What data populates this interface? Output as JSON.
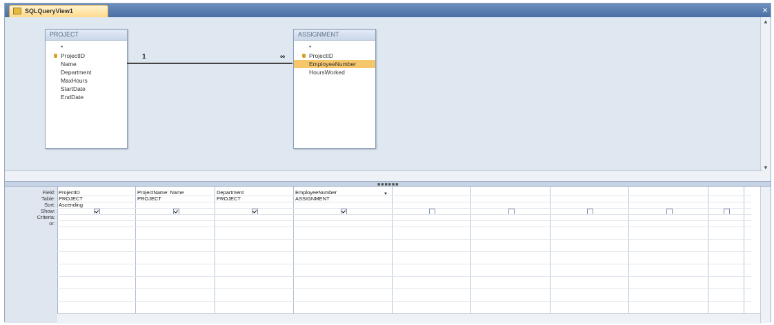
{
  "tab": {
    "title": "SQLQueryView1"
  },
  "tables": [
    {
      "title": "PROJECT",
      "fields": [
        "*",
        "ProjectID",
        "Name",
        "Department",
        "MaxHours",
        "StartDate",
        "EndDate"
      ],
      "key_index": 1,
      "selected_index": -1
    },
    {
      "title": "ASSIGNMENT",
      "fields": [
        "*",
        "ProjectID",
        "EmployeeNumber",
        "HoursWorked"
      ],
      "key_index": 1,
      "selected_index": 2
    }
  ],
  "relationship": {
    "one": "1",
    "many": "∞"
  },
  "row_headers": [
    "Field:",
    "Table:",
    "Sort:",
    "Show:",
    "Criteria:",
    "or:"
  ],
  "columns": [
    {
      "field": "ProjectID",
      "table": "PROJECT",
      "sort": "Ascending",
      "show": true
    },
    {
      "field": "ProjectName: Name",
      "table": "PROJECT",
      "sort": "",
      "show": true
    },
    {
      "field": "Department",
      "table": "PROJECT",
      "sort": "",
      "show": true
    },
    {
      "field": "EmployeeNumber",
      "table": "ASSIGNMENT",
      "sort": "",
      "show": true,
      "dropdown": true
    },
    {
      "field": "",
      "table": "",
      "sort": "",
      "show": false
    },
    {
      "field": "",
      "table": "",
      "sort": "",
      "show": false
    },
    {
      "field": "",
      "table": "",
      "sort": "",
      "show": false
    },
    {
      "field": "",
      "table": "",
      "sort": "",
      "show": false
    },
    {
      "field": "",
      "table": "",
      "sort": "",
      "show": false
    }
  ],
  "icons": {
    "tab": "query-icon",
    "close": "close-icon"
  },
  "colors": {
    "accent": "#f6c66a",
    "tab_bar": "#4a6fa5"
  }
}
